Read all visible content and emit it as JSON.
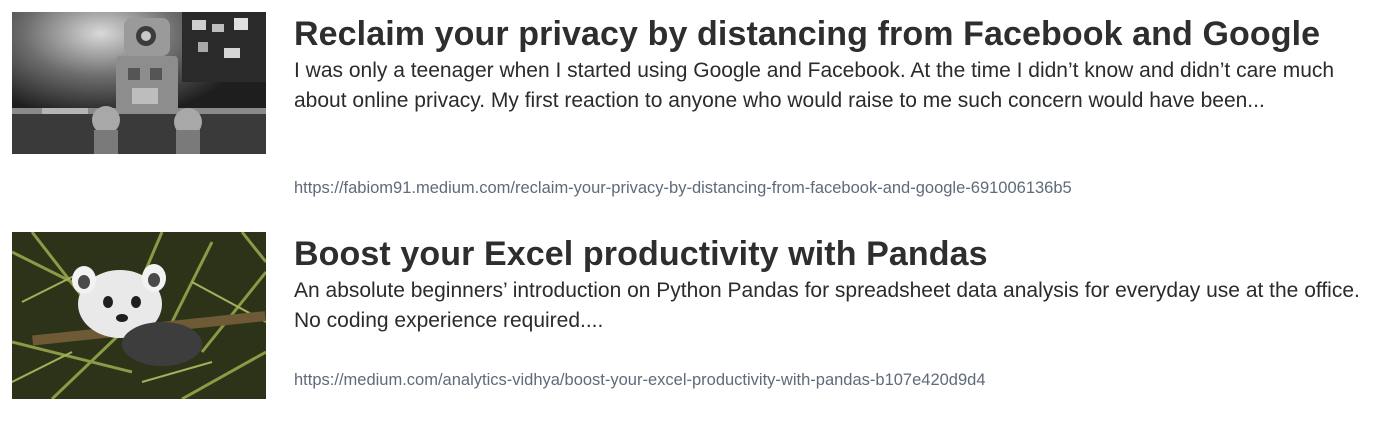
{
  "articles": [
    {
      "title": "Reclaim your privacy by distancing from Facebook and Google",
      "description": "I was only a teenager when I started using Google and Facebook. At the time I didn’t know and didn’t care much about online privacy. My first reaction to anyone who would raise to me such concern would have been...",
      "url": "https://fabiom91.medium.com/reclaim-your-privacy-by-distancing-from-facebook-and-google-691006136b5",
      "thumbnail": "robot-photo"
    },
    {
      "title": "Boost your Excel productivity with Pandas",
      "description": "An absolute beginners’ introduction on Python Pandas for spreadsheet data analysis for everyday use at the office. No coding experience required....",
      "url": "https://medium.com/analytics-vidhya/boost-your-excel-productivity-with-pandas-b107e420d9d4",
      "thumbnail": "red-panda-photo"
    }
  ]
}
